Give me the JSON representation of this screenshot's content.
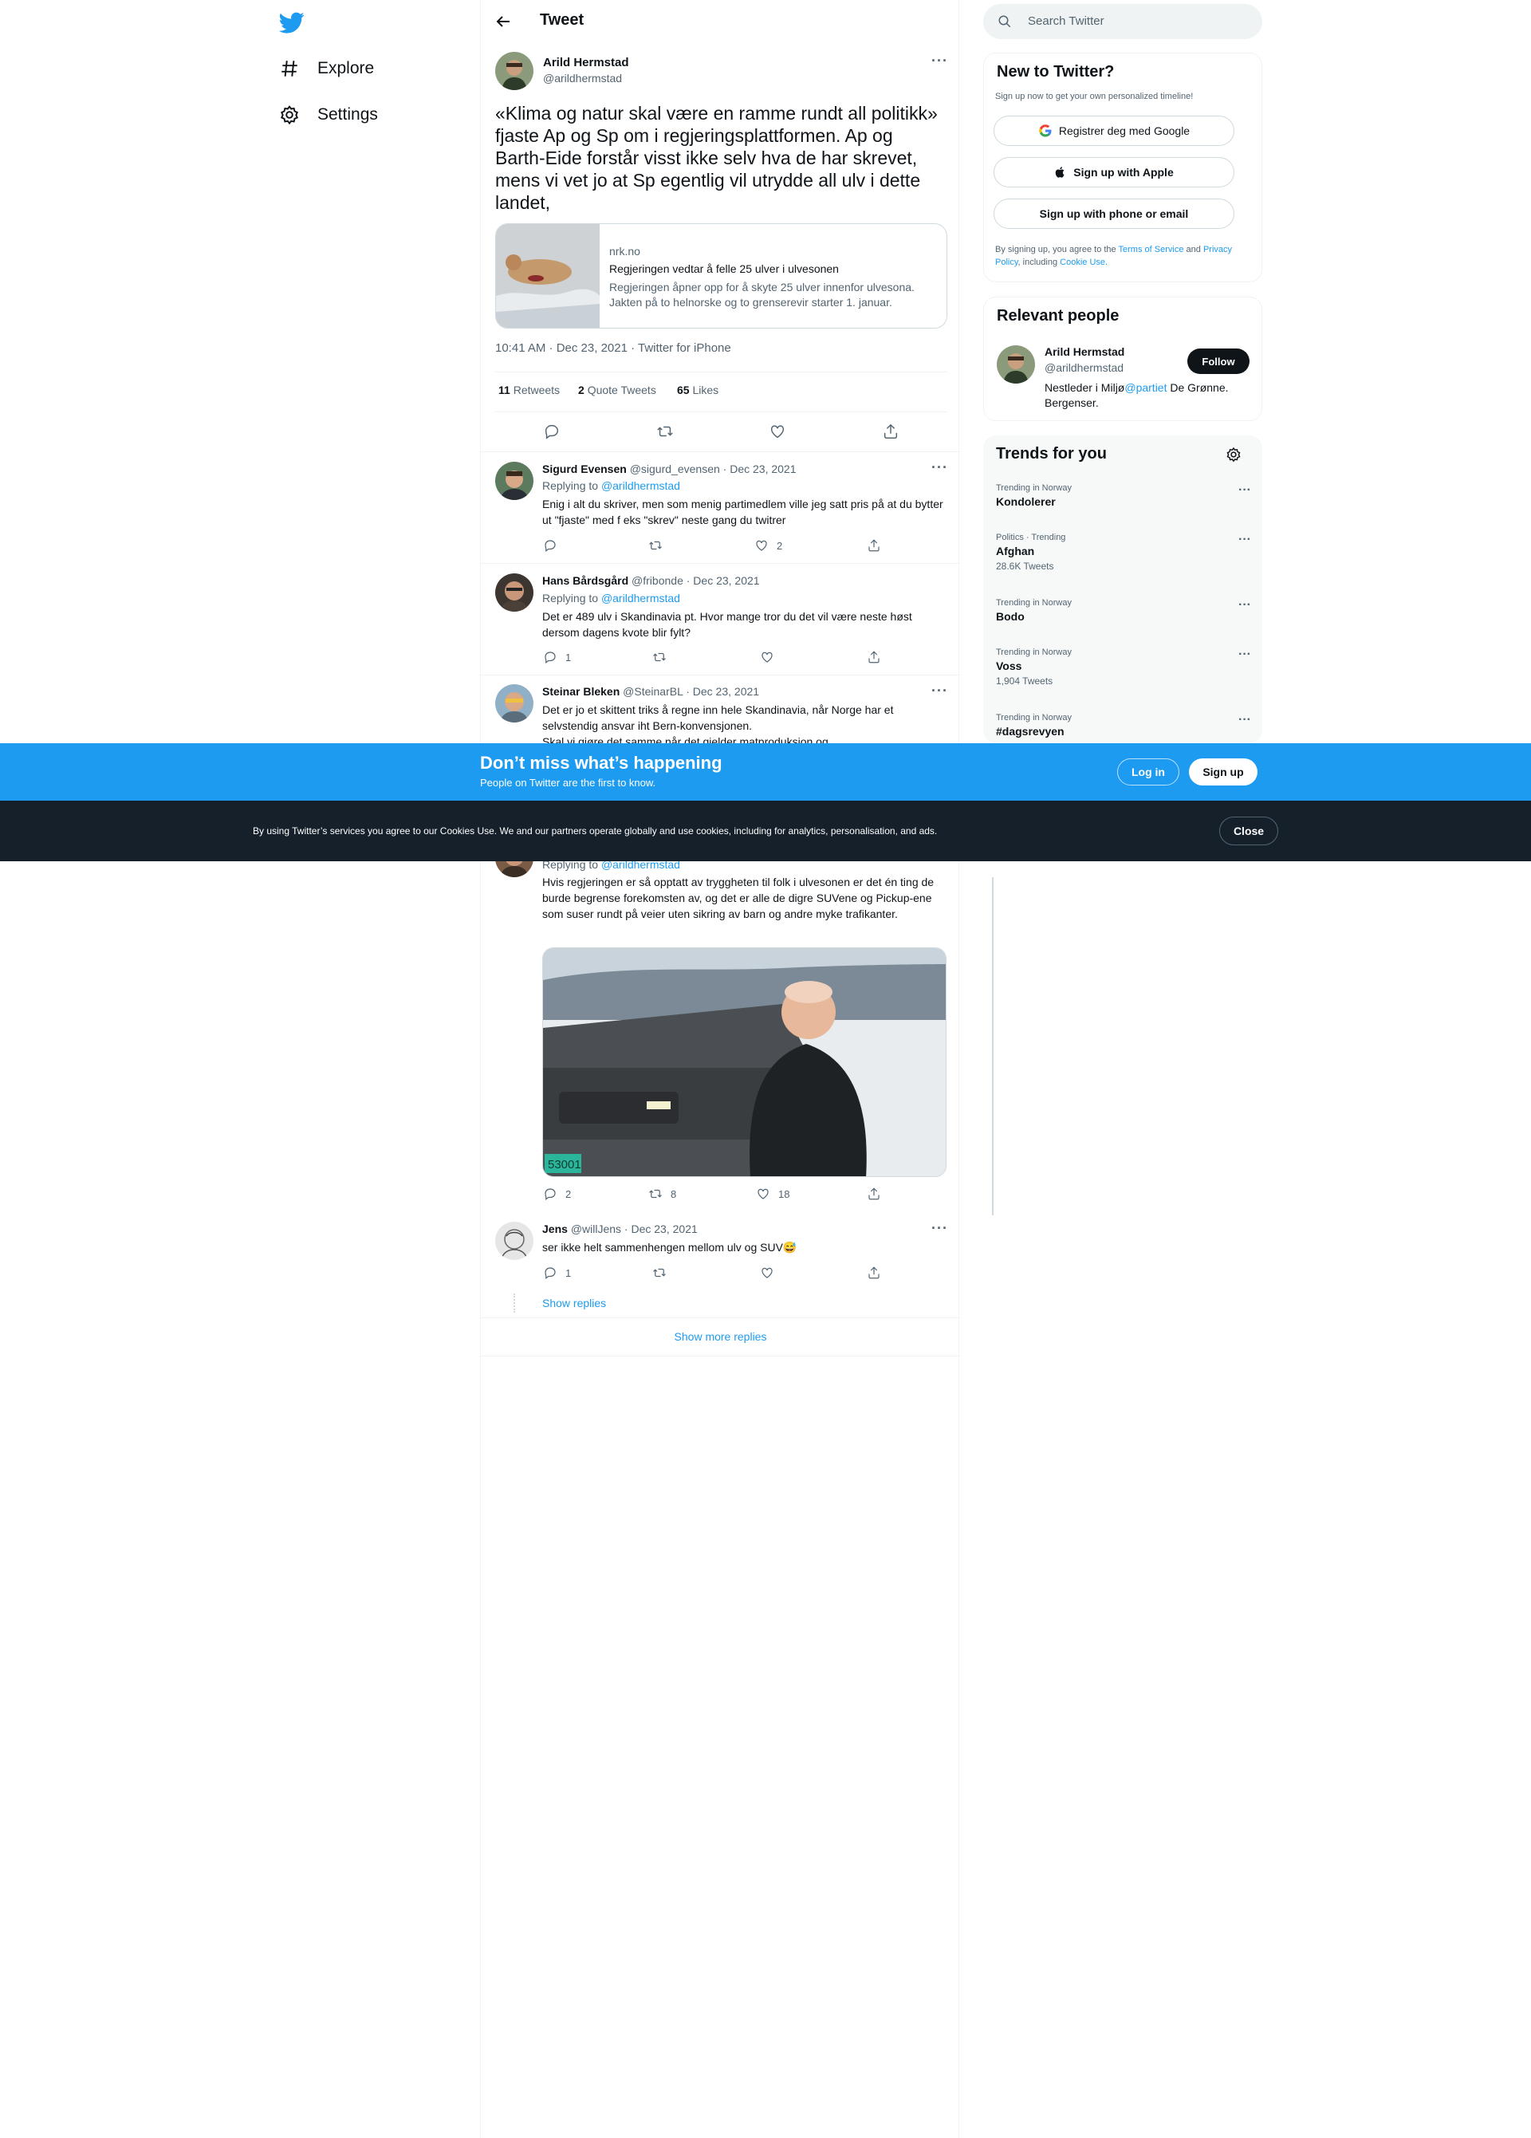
{
  "nav": {
    "logo": "twitter-bird-icon",
    "items": [
      {
        "label": "Explore",
        "icon": "hashtag-icon"
      },
      {
        "label": "Settings",
        "icon": "gear-icon"
      }
    ]
  },
  "header": {
    "title": "Tweet"
  },
  "tweet": {
    "author_name": "Arild Hermstad",
    "author_handle": "@arildhermstad",
    "text": "«Klima og natur skal være en ramme rundt all politikk» fjaste Ap og Sp om i regjeringsplattformen. Ap og Barth-Eide forstår visst ikke selv hva de har skrevet, mens vi vet jo at Sp egentlig vil utrydde all ulv i dette landet,",
    "card": {
      "domain": "nrk.no",
      "title": "Regjeringen vedtar å felle 25 ulver i ulvesonen",
      "description": "Regjeringen åpner opp for å skyte 25 ulver innenfor ulvesona. Jakten på to helnorske og to grenserevir starter 1. januar."
    },
    "meta": "10:41 AM · Dec 23, 2021 · Twitter for iPhone",
    "stats": {
      "retweets_count": "11",
      "retweets_label": "Retweets",
      "quotes_count": "2",
      "quotes_label": "Quote Tweets",
      "likes_count": "65",
      "likes_label": "Likes"
    }
  },
  "replies": [
    {
      "name": "Sigurd Evensen",
      "handle_date": "@sigurd_evensen · Dec 23, 2021",
      "replying_prefix": "Replying to",
      "replying_to": "@arildhermstad",
      "text": "Enig i alt du skriver, men som menig partimedlem ville jeg satt pris på at du bytter ut \"fjaste\" med f eks \"skrev\" neste gang du twitrer",
      "reply_count": "",
      "retweet_count": "",
      "like_count": "2"
    },
    {
      "name": "Hans Bårdsgård",
      "handle_date": "@fribonde · Dec 23, 2021",
      "replying_prefix": "Replying to",
      "replying_to": "@arildhermstad",
      "text": "Det er 489 ulv i Skandinavia pt. Hvor mange tror du det vil være neste høst dersom dagens kvote blir fylt?",
      "reply_count": "1",
      "retweet_count": "",
      "like_count": ""
    },
    {
      "name": "Steinar Bleken",
      "handle_date": "@SteinarBL · Dec 23, 2021",
      "text": "Det er jo et skittent triks å regne inn hele Skandinavia, når Norge har et selvstendig ansvar iht Bern-konvensjonen.\nSkal vi gjøre det samme når det gjelder matproduksjon og"
    },
    {
      "replying_prefix": "Replying to",
      "replying_to": "@arildhermstad",
      "text": "Hvis regjeringen er så opptatt av tryggheten til folk i ulvesonen er det én ting de burde begrense forekomsten av, og det er alle de digre SUVene og Pickup-ene som suser rundt på veier uten sikring av barn og andre myke trafikanter.",
      "image_plate": "53001",
      "reply_count": "2",
      "retweet_count": "8",
      "like_count": "18"
    },
    {
      "name": "Jens",
      "handle_date": "@willJens · Dec 23, 2021",
      "text": "ser ikke helt sammenhengen mellom ulv og SUV😅",
      "reply_count": "1",
      "retweet_count": "",
      "like_count": ""
    }
  ],
  "show_replies": "Show replies",
  "show_more_replies": "Show more replies",
  "sidebar": {
    "search_placeholder": "Search Twitter",
    "new_to_twitter": {
      "title": "New to Twitter?",
      "subtitle": "Sign up now to get your own personalized timeline!",
      "google_label": "Registrer deg med Google",
      "apple_label": "Sign up with Apple",
      "phone_label": "Sign up with phone or email",
      "terms_prefix": "By signing up, you agree to the",
      "terms_link": "Terms of Service",
      "and": "and",
      "privacy_link": "Privacy Policy",
      "including": ", including",
      "cookie_link": "Cookie Use."
    },
    "relevant": {
      "title": "Relevant people",
      "name": "Arild Hermstad",
      "handle": "@arildhermstad",
      "follow_label": "Follow",
      "bio_prefix": "Nestleder i Miljø",
      "bio_link": "@partiet",
      "bio_suffix": " De Grønne. Bergenser."
    },
    "trends": {
      "title": "Trends for you",
      "items": [
        {
          "category": "Trending in Norway",
          "name": "Kondolerer",
          "count": ""
        },
        {
          "category": "Politics · Trending",
          "name": "Afghan",
          "count": "28.6K Tweets"
        },
        {
          "category": "Trending in Norway",
          "name": "Bodo",
          "count": ""
        },
        {
          "category": "Trending in Norway",
          "name": "Voss",
          "count": "1,904 Tweets"
        },
        {
          "category": "Trending in Norway",
          "name": "#dagsrevyen",
          "count": ""
        }
      ]
    }
  },
  "banner": {
    "title": "Don’t miss what’s happening",
    "subtitle": "People on Twitter are the first to know.",
    "login_label": "Log in",
    "signup_label": "Sign up"
  },
  "cookie": {
    "text": "By using Twitter’s services you agree to our Cookies Use. We and our partners operate globally and use cookies, including for analytics, personalisation, and ads.",
    "close_label": "Close"
  },
  "colors": {
    "accent": "#1d9bf0",
    "text": "#0f1419",
    "muted": "#536471",
    "border": "#eff3f4",
    "cookie_bg": "#15202b"
  }
}
